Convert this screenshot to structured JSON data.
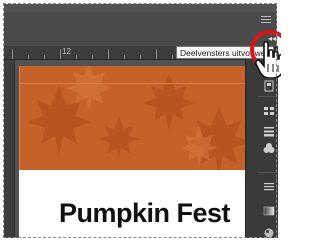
{
  "ruler": {
    "label": "12"
  },
  "tooltip": {
    "text": "Deelvensters uitvouwen"
  },
  "document": {
    "title": "Pumpkin Fest"
  },
  "colors": {
    "banner": "#c6612a",
    "highlight_ring": "#d9121b",
    "panel": "#3a3a3a"
  },
  "icons": {
    "prefs": "panel-options-icon",
    "collapse": "expand-panels-icon",
    "cursor": "hand-pointer-icon",
    "panel_items": [
      "pages-icon",
      "links-icon",
      "stroke-icon",
      "color-icon",
      "swatches-icon",
      "gradient-icon",
      "effects-icon"
    ]
  }
}
